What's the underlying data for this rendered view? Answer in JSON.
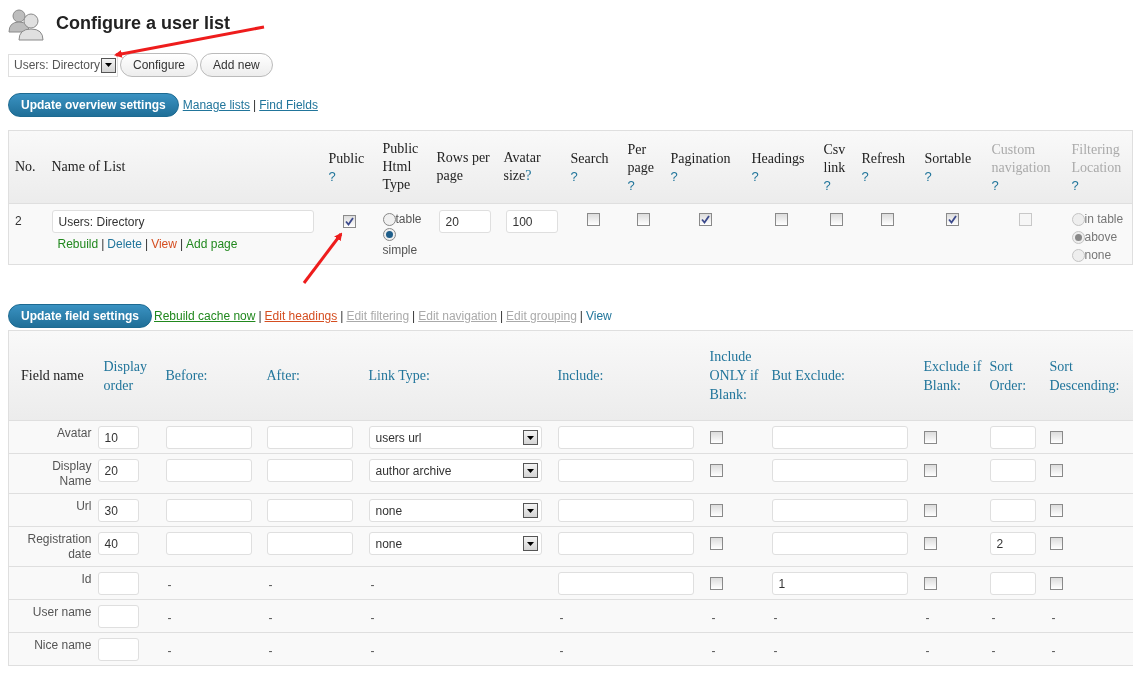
{
  "page": {
    "title": "Configure a user list"
  },
  "list_picker": {
    "value": "Users: Directory",
    "buttons": [
      "Configure",
      "Add new"
    ]
  },
  "overview_bar": {
    "button": "Update overview settings",
    "separator": "|",
    "links": [
      {
        "label": "Manage lists"
      },
      {
        "label": "Find Fields"
      }
    ]
  },
  "overview": {
    "columns": [
      {
        "label": "No.",
        "disabled": false
      },
      {
        "label": "Name of List",
        "disabled": false
      },
      {
        "label": "Public",
        "help": "?",
        "disabled": false
      },
      {
        "label": "Public Html Type",
        "disabled": false
      },
      {
        "label": "Rows per page",
        "disabled": false
      },
      {
        "label": "Avatar size",
        "help": "?",
        "inline_help": true,
        "disabled": false
      },
      {
        "label": "Search",
        "help": "?",
        "disabled": false
      },
      {
        "label": "Per page",
        "help": "?",
        "disabled": false
      },
      {
        "label": "Pagination",
        "help": "?",
        "disabled": false
      },
      {
        "label": "Headings",
        "help": "?",
        "disabled": false
      },
      {
        "label": "Csv link",
        "help": "?",
        "disabled": false
      },
      {
        "label": "Refresh",
        "help": "?",
        "disabled": false
      },
      {
        "label": "Sortable",
        "help": "?",
        "disabled": false
      },
      {
        "label": "Custom navigation",
        "help": "?",
        "disabled": true
      },
      {
        "label": "Filtering Location",
        "help": "?",
        "disabled": true
      }
    ],
    "separator": "|",
    "rows": [
      {
        "number": "2",
        "name": "Users: Directory",
        "actions": [
          {
            "label": "Rebuild",
            "color": "#21881e"
          },
          {
            "label": "Delete",
            "color": "#21759b"
          },
          {
            "label": "View",
            "color": "#d54e21"
          },
          {
            "label": "Add page",
            "color": "#21881e"
          }
        ],
        "public": true,
        "html_type": [
          {
            "label": "table",
            "selected": false
          },
          {
            "label": "simple",
            "selected": true
          }
        ],
        "rows_per_page": "20",
        "avatar_size": "100",
        "search": false,
        "per_page": false,
        "pagination": true,
        "headings": false,
        "csv_link": false,
        "refresh": false,
        "sortable": true,
        "custom_navigation": false,
        "filtering_location": [
          {
            "label": "in table",
            "selected": false
          },
          {
            "label": "above",
            "selected": true
          },
          {
            "label": "none",
            "selected": false
          }
        ]
      }
    ]
  },
  "fields_bar": {
    "button": "Update field settings",
    "separator": "|",
    "links": [
      {
        "label": "Rebuild cache now",
        "color": "#21881e",
        "underline": true
      },
      {
        "label": "Edit headings",
        "color": "#d54e21",
        "underline": true
      },
      {
        "label": "Edit filtering",
        "color": "#aaaaaa",
        "underline": true
      },
      {
        "label": "Edit navigation",
        "color": "#aaaaaa",
        "underline": true
      },
      {
        "label": "Edit grouping",
        "color": "#aaaaaa",
        "underline": true
      },
      {
        "label": "View",
        "color": "#21759b",
        "underline": false
      }
    ]
  },
  "fields": {
    "columns": [
      {
        "label": "Field name",
        "kind": "plain"
      },
      {
        "label": "Display order",
        "kind": "link"
      },
      {
        "label": "Before:",
        "kind": "link"
      },
      {
        "label": "After:",
        "kind": "link"
      },
      {
        "label": "Link Type:",
        "kind": "link"
      },
      {
        "label": "Include:",
        "kind": "link"
      },
      {
        "label": "Include ONLY if Blank:",
        "kind": "link"
      },
      {
        "label": "But Exclude:",
        "kind": "link"
      },
      {
        "label": "Exclude if Blank:",
        "kind": "link"
      },
      {
        "label": "Sort Order:",
        "kind": "link"
      },
      {
        "label": "Sort Descending:",
        "kind": "link"
      }
    ],
    "rows": [
      {
        "cells": [
          {
            "kind": "name",
            "text": "Avatar"
          },
          {
            "kind": "input",
            "value": "10"
          },
          {
            "kind": "input"
          },
          {
            "kind": "input"
          },
          {
            "kind": "select",
            "value": "users url"
          },
          {
            "kind": "input"
          },
          {
            "kind": "checkbox",
            "checked": false
          },
          {
            "kind": "input"
          },
          {
            "kind": "checkbox",
            "checked": false
          },
          {
            "kind": "input"
          },
          {
            "kind": "checkbox",
            "checked": false
          }
        ]
      },
      {
        "cells": [
          {
            "kind": "name",
            "text": "Display Name"
          },
          {
            "kind": "input",
            "value": "20"
          },
          {
            "kind": "input"
          },
          {
            "kind": "input"
          },
          {
            "kind": "select",
            "value": "author archive"
          },
          {
            "kind": "input"
          },
          {
            "kind": "checkbox",
            "checked": false
          },
          {
            "kind": "input"
          },
          {
            "kind": "checkbox",
            "checked": false
          },
          {
            "kind": "input"
          },
          {
            "kind": "checkbox",
            "checked": false
          }
        ]
      },
      {
        "cells": [
          {
            "kind": "name",
            "text": "Url"
          },
          {
            "kind": "input",
            "value": "30"
          },
          {
            "kind": "input"
          },
          {
            "kind": "input"
          },
          {
            "kind": "select",
            "value": "none"
          },
          {
            "kind": "input"
          },
          {
            "kind": "checkbox",
            "checked": false
          },
          {
            "kind": "input"
          },
          {
            "kind": "checkbox",
            "checked": false
          },
          {
            "kind": "input"
          },
          {
            "kind": "checkbox",
            "checked": false
          }
        ]
      },
      {
        "cells": [
          {
            "kind": "name",
            "text": "Registration date"
          },
          {
            "kind": "input",
            "value": "40"
          },
          {
            "kind": "input"
          },
          {
            "kind": "input"
          },
          {
            "kind": "select",
            "value": "none"
          },
          {
            "kind": "input"
          },
          {
            "kind": "checkbox",
            "checked": false
          },
          {
            "kind": "input"
          },
          {
            "kind": "checkbox",
            "checked": false
          },
          {
            "kind": "input",
            "value": "2"
          },
          {
            "kind": "checkbox",
            "checked": false
          }
        ]
      },
      {
        "cells": [
          {
            "kind": "name",
            "text": "Id"
          },
          {
            "kind": "input"
          },
          {
            "kind": "dash",
            "text": "-"
          },
          {
            "kind": "dash",
            "text": "-"
          },
          {
            "kind": "dash",
            "text": "-"
          },
          {
            "kind": "input"
          },
          {
            "kind": "checkbox",
            "checked": false
          },
          {
            "kind": "input",
            "value": "1"
          },
          {
            "kind": "checkbox",
            "checked": false
          },
          {
            "kind": "input"
          },
          {
            "kind": "checkbox",
            "checked": false
          }
        ]
      },
      {
        "cells": [
          {
            "kind": "name",
            "text": "User name"
          },
          {
            "kind": "input"
          },
          {
            "kind": "dash",
            "text": "-"
          },
          {
            "kind": "dash",
            "text": "-"
          },
          {
            "kind": "dash",
            "text": "-"
          },
          {
            "kind": "dash",
            "text": "-"
          },
          {
            "kind": "dash",
            "text": "-"
          },
          {
            "kind": "dash",
            "text": "-"
          },
          {
            "kind": "dash",
            "text": "-"
          },
          {
            "kind": "dash",
            "text": "-"
          },
          {
            "kind": "dash",
            "text": "-"
          }
        ]
      },
      {
        "cells": [
          {
            "kind": "name",
            "text": "Nice name"
          },
          {
            "kind": "input"
          },
          {
            "kind": "dash",
            "text": "-"
          },
          {
            "kind": "dash",
            "text": "-"
          },
          {
            "kind": "dash",
            "text": "-"
          },
          {
            "kind": "dash",
            "text": "-"
          },
          {
            "kind": "dash",
            "text": "-"
          },
          {
            "kind": "dash",
            "text": "-"
          },
          {
            "kind": "dash",
            "text": "-"
          },
          {
            "kind": "dash",
            "text": "-"
          },
          {
            "kind": "dash",
            "text": "-"
          }
        ]
      }
    ]
  }
}
